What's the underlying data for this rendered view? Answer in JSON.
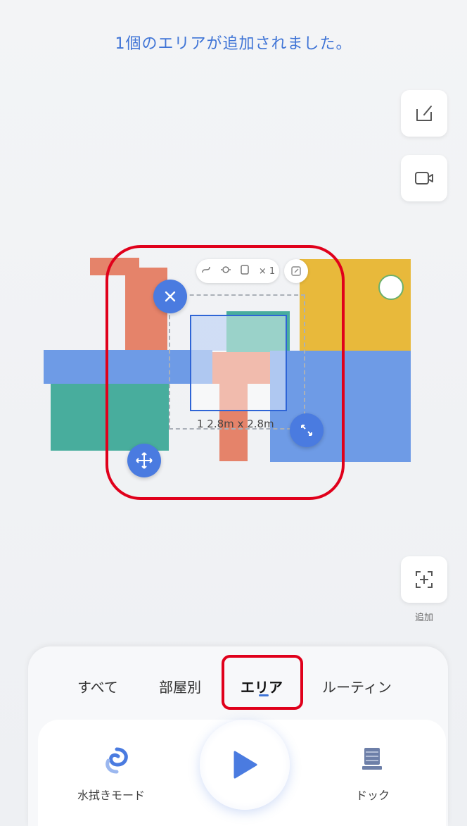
{
  "notice": "1個のエリアが追加されました。",
  "side_buttons": {
    "edit_map_icon": "map-edit-icon",
    "video_icon": "video-camera-icon",
    "add_area_label": "追加"
  },
  "selection": {
    "tools_text": "× 1",
    "dimensions": "1  2.8m x 2.8m"
  },
  "tabs": [
    {
      "label": "すべて"
    },
    {
      "label": "部屋別"
    },
    {
      "label": "エリア"
    },
    {
      "label": "ルーティン"
    }
  ],
  "controls": {
    "mop_mode_label": "水拭きモード",
    "dock_label": "ドック"
  },
  "colors": {
    "accent": "#3f74d6",
    "highlight_red": "#e0001b",
    "room_orange": "#e5836a",
    "room_teal": "#48ad9d",
    "room_blue": "#6e9be6",
    "room_yellow": "#e8b93b"
  }
}
